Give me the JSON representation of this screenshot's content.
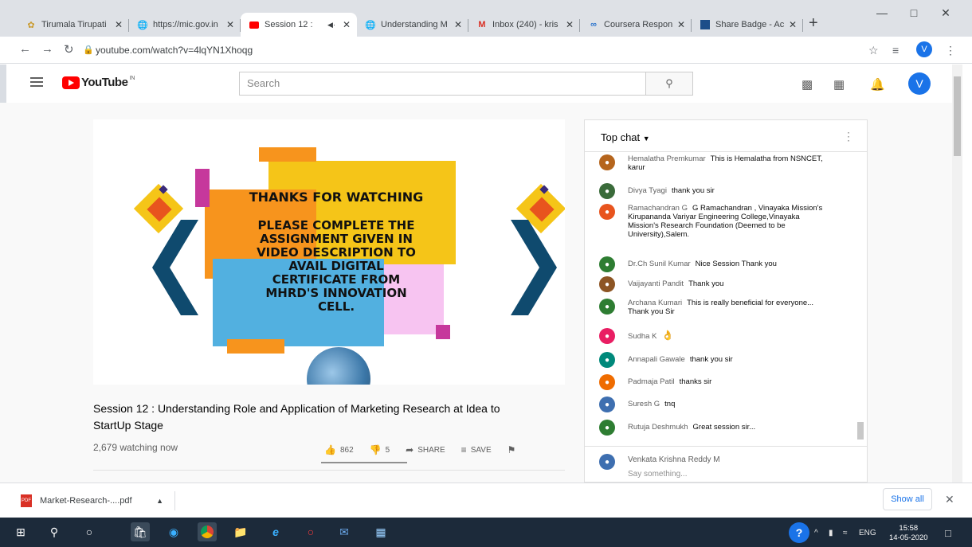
{
  "tabs": [
    {
      "label": "Tirumala Tirupati",
      "icon": "tirumala-favicon-icon",
      "active": false
    },
    {
      "label": "https://mic.gov.in",
      "icon": "globe-icon",
      "active": false
    },
    {
      "label": "Session 12 :",
      "icon": "youtube-favicon-icon",
      "active": true,
      "audio": "◀·"
    },
    {
      "label": "Understanding M",
      "icon": "globe-icon",
      "active": false
    },
    {
      "label": "Inbox (240) - kris",
      "icon": "gmail-icon",
      "active": false
    },
    {
      "label": "Coursera Respon",
      "icon": "coursera-icon",
      "active": false
    },
    {
      "label": "Share Badge - Ac",
      "icon": "badge-icon",
      "active": false
    }
  ],
  "address": {
    "url": "youtube.com/watch?v=4lqYN1Xhoqg"
  },
  "profile_initial": "V",
  "youtube": {
    "logo_text": "YouTube",
    "logo_sup": "IN",
    "search_placeholder": "Search"
  },
  "video": {
    "slide_heading": "THANKS FOR WATCHING",
    "slide_lines": [
      "PLEASE COMPLETE THE",
      "ASSIGNMENT GIVEN IN",
      "VIDEO DESCRIPTION TO",
      "AVAIL DIGITAL",
      "CERTIFICATE FROM",
      "MHRD'S INNOVATION",
      "CELL."
    ],
    "title_line1": "Session 12 : Understanding Role and Application of Marketing Research at Idea to",
    "title_line2": "StartUp Stage",
    "watching": "2,679 watching now",
    "likes": "862",
    "dislikes": "5",
    "share_label": "SHARE",
    "save_label": "SAVE"
  },
  "chat": {
    "header": "Top chat",
    "messages": [
      {
        "author": "Hemalatha Premkumar",
        "text": "This is Hemalatha from NSNCET, karur",
        "avatar_color": "#b5651d"
      },
      {
        "author": "Divya Tyagi",
        "text": "thank you sir",
        "avatar_color": "#3a6b3a"
      },
      {
        "author": "Ramachandran G",
        "text": "G Ramachandran , Vinayaka Mission's Kirupananda Variyar Engineering College,Vinayaka Mission's Research Foundation (Deemed to be University),Salem.",
        "avatar_color": "#e8541e"
      },
      {
        "author": "Dr.Ch Sunil Kumar",
        "text": "Nice Session Thank you",
        "avatar_color": "#2e7d32"
      },
      {
        "author": "Vaijayanti Pandit",
        "text": "Thank you",
        "avatar_color": "#8d5524"
      },
      {
        "author": "Archana Kumari",
        "text": "This is really beneficial for everyone... Thank you Sir",
        "avatar_color": "#2e7d32"
      },
      {
        "author": "Sudha K",
        "text": "",
        "emoji": "👌",
        "avatar_color": "#e91e63"
      },
      {
        "author": "Annapali Gawale",
        "text": "thank you sir",
        "avatar_color": "#00897b"
      },
      {
        "author": "Padmaja Patil",
        "text": "thanks sir",
        "avatar_color": "#ef6c00"
      },
      {
        "author": "Suresh G",
        "text": "tnq",
        "avatar_color": "#3e6fb0"
      },
      {
        "author": "Rutuja Deshmukh",
        "text": "Great session sir...",
        "avatar_color": "#2e7d32"
      }
    ],
    "input_name": "Venkata Krishna Reddy M",
    "input_placeholder": "Say something..."
  },
  "downloads": {
    "file": "Market-Research-....pdf",
    "show_all": "Show all"
  },
  "taskbar": {
    "lang": "ENG",
    "time": "15:58",
    "date": "14-05-2020"
  }
}
